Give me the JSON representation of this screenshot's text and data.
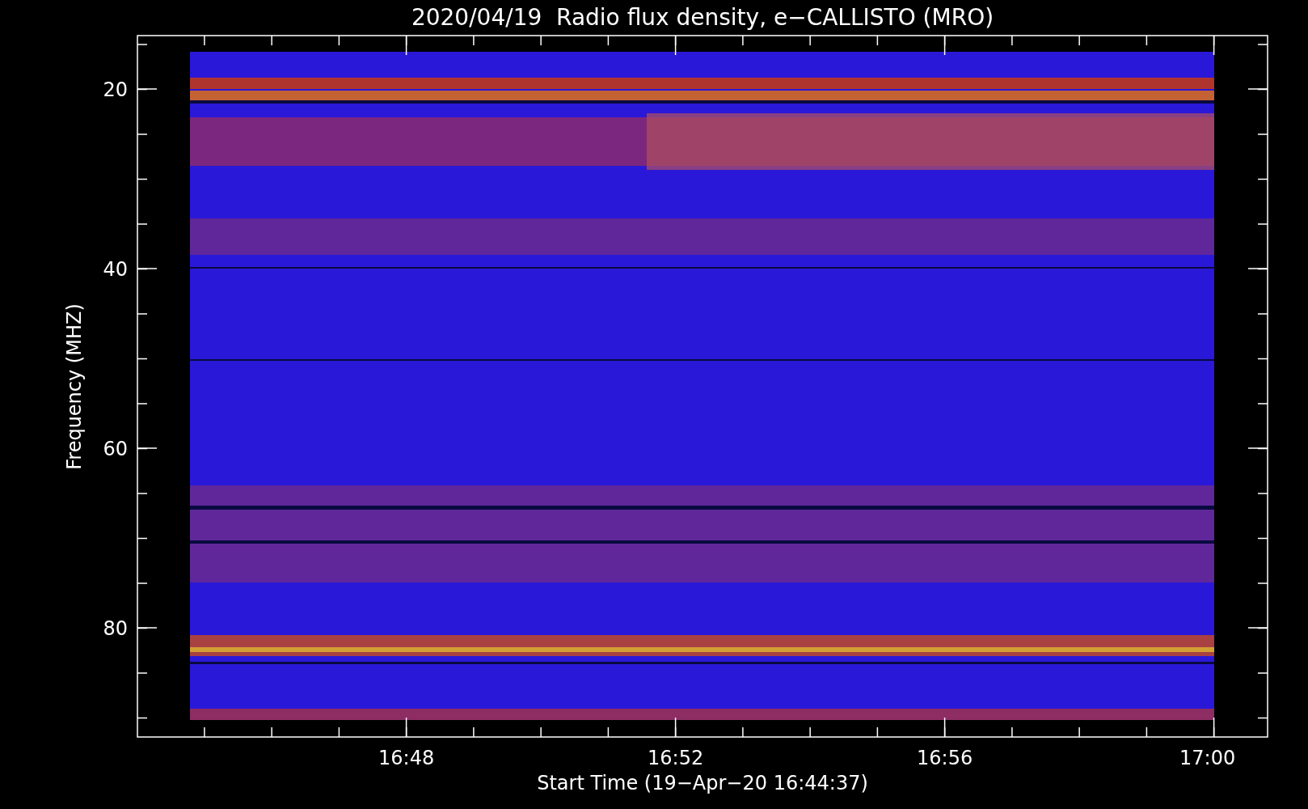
{
  "title": "2020/04/19  Radio flux density, e−CALLISTO (MRO)",
  "y_axis": {
    "label": "Frequency (MHZ)",
    "ticks": [
      "20",
      "40",
      "60",
      "80"
    ]
  },
  "x_axis": {
    "label": "Start Time (19−Apr−20 16:44:37)",
    "ticks": [
      "16:48",
      "16:52",
      "16:56",
      "17:00"
    ]
  }
}
